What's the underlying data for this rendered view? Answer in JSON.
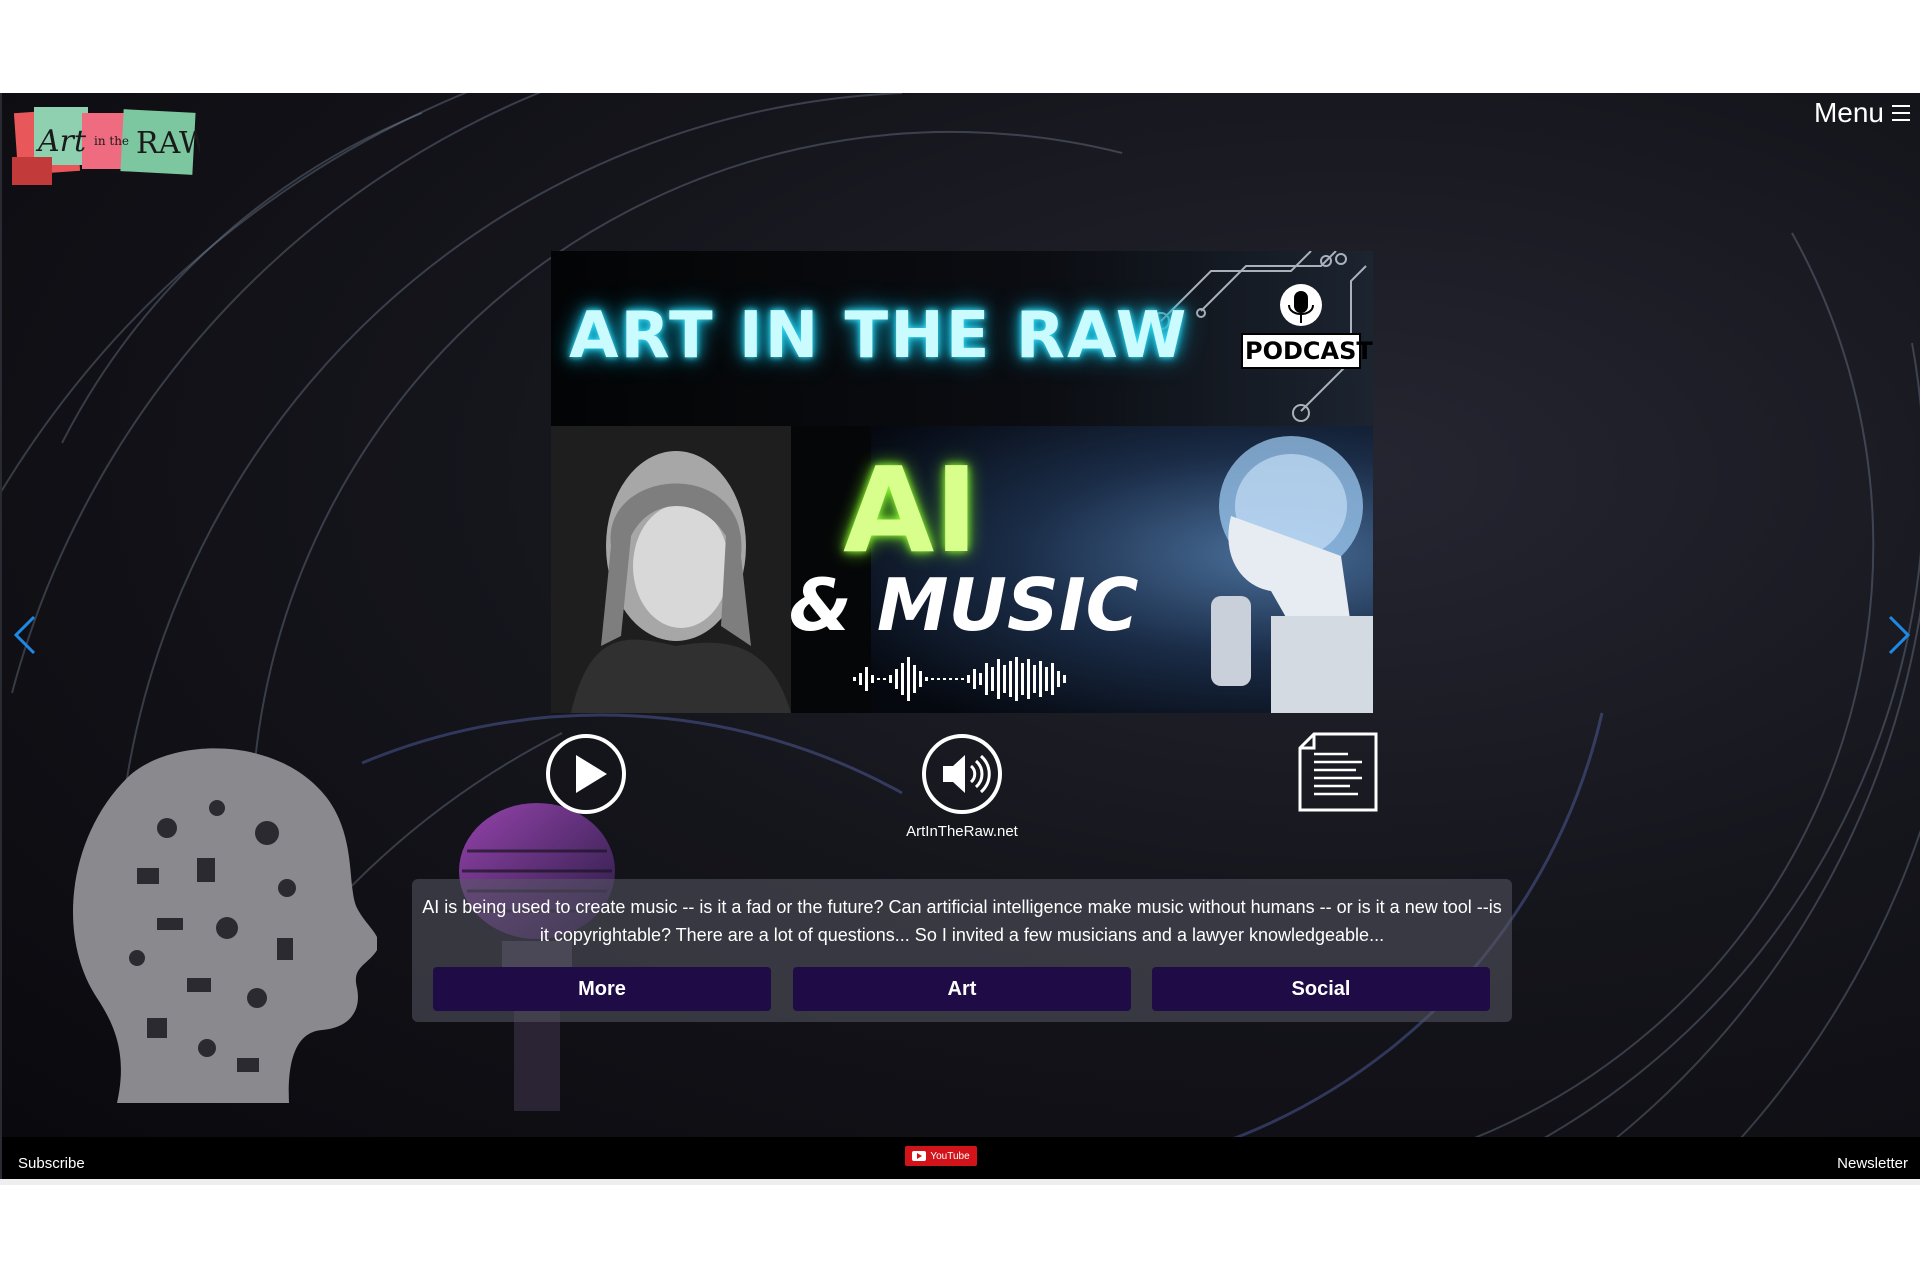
{
  "nav": {
    "menu_label": "Menu"
  },
  "logo": {
    "text": "Art in the RAW"
  },
  "hero": {
    "title": "ART IN THE RAW",
    "badge": "PODCAST",
    "headline": "AI",
    "subheadline": "& MUSIC"
  },
  "player": {
    "site_label": "ArtInTheRaw.net"
  },
  "episode": {
    "description": "AI is being used to create music -- is it a fad or the future?  Can artificial intelligence make music without humans -- or is it a new tool --is it copyrightable? There are a lot of questions... So I invited a few musicians and a lawyer knowledgeable...",
    "buttons": {
      "more": "More",
      "art": "Art",
      "social": "Social"
    }
  },
  "footer": {
    "subscribe": "Subscribe",
    "youtube": "YouTube",
    "newsletter": "Newsletter"
  },
  "colors": {
    "button_bg": "#1f0b45",
    "title_glow": "#3ee6ff",
    "ai_glow": "#9bff3a",
    "arrow": "#1e88e5",
    "youtube_red": "#d2141a"
  }
}
